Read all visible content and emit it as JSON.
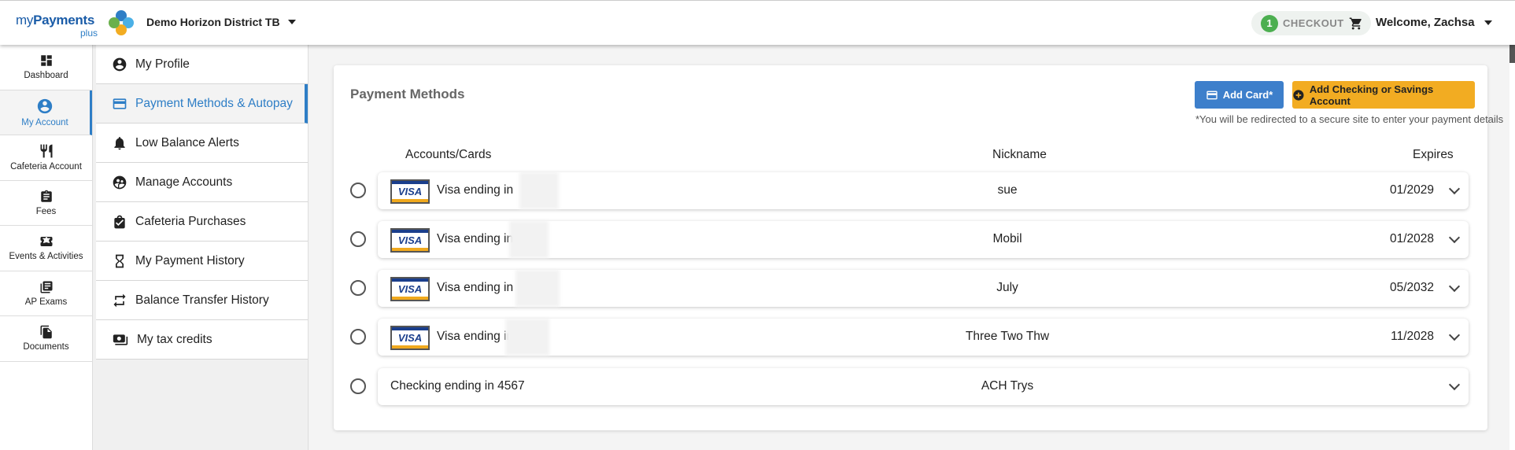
{
  "brand": {
    "logo_my": "my",
    "logo_payments": "Payments",
    "logo_plus": "plus"
  },
  "header": {
    "district": "Demo Horizon District TB",
    "cart_count": "1",
    "checkout_label": "CHECKOUT",
    "welcome": "Welcome, Zachsa"
  },
  "leftnav": [
    {
      "label": "Dashboard",
      "icon": "dashboard-icon"
    },
    {
      "label": "My Account",
      "icon": "account-circle-icon"
    },
    {
      "label": "Cafeteria Account",
      "icon": "fork-knife-icon"
    },
    {
      "label": "Fees",
      "icon": "clipboard-icon"
    },
    {
      "label": "Events & Activities",
      "icon": "ticket-icon"
    },
    {
      "label": "AP Exams",
      "icon": "book-icon"
    },
    {
      "label": "Documents",
      "icon": "documents-icon"
    }
  ],
  "subnav": [
    {
      "label": "My Profile",
      "icon": "profile-icon"
    },
    {
      "label": "Payment Methods & Autopay",
      "icon": "credit-card-icon"
    },
    {
      "label": "Low Balance Alerts",
      "icon": "bell-icon"
    },
    {
      "label": "Manage Accounts",
      "icon": "group-icon"
    },
    {
      "label": "Cafeteria Purchases",
      "icon": "shopping-bag-icon"
    },
    {
      "label": "My Payment History",
      "icon": "hourglass-icon"
    },
    {
      "label": "Balance Transfer History",
      "icon": "transfer-icon"
    },
    {
      "label": "My tax credits",
      "icon": "money-icon"
    }
  ],
  "main": {
    "title": "Payment Methods",
    "add_card_label": "Add Card*",
    "add_ach_label": "Add Checking or Savings Account",
    "redirect_note": "*You will be redirected to a secure site to enter your payment details",
    "columns": {
      "accounts": "Accounts/Cards",
      "nickname": "Nickname",
      "expires": "Expires"
    },
    "rows": [
      {
        "type": "visa",
        "account": "Visa ending in",
        "nickname": "sue",
        "expires": "01/2029"
      },
      {
        "type": "visa",
        "account": "Visa ending in",
        "nickname": "Mobil",
        "expires": "01/2028"
      },
      {
        "type": "visa",
        "account": "Visa ending in",
        "nickname": "July",
        "expires": "05/2032"
      },
      {
        "type": "visa",
        "account": "Visa ending in",
        "nickname": "Three Two Thw",
        "expires": "11/2028"
      },
      {
        "type": "checking",
        "account": "Checking ending in 4567",
        "nickname": "ACH Trys",
        "expires": ""
      }
    ]
  },
  "colors": {
    "accent": "#2e7ec6",
    "card_button": "#3d7fcb",
    "ach_button": "#f2ac22",
    "arrow": "#1e8ee6"
  }
}
